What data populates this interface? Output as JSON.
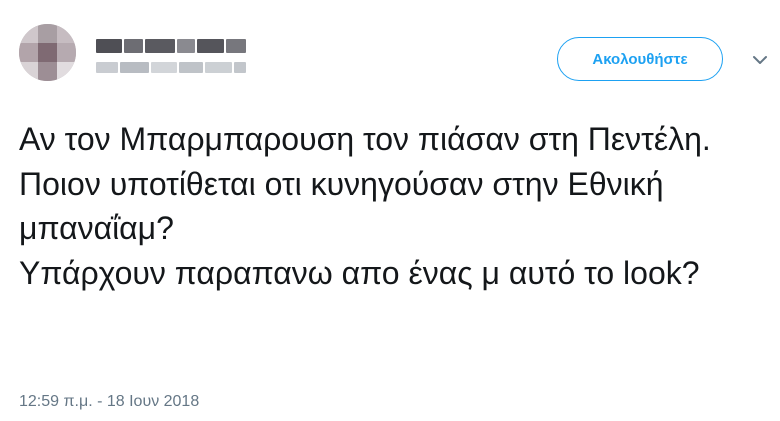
{
  "tweet": {
    "follow_label": "Ακολουθήστε",
    "text": "Αν τον Μπαρμπαρουση τον πιάσαν στη Πεντέλη.\nΠοιον υποτίθεται οτι κυνηγούσαν στην Εθνική μπαναΐαμ?\nΥπάρχουν παραπανω απο ένας μ αυτό το look?",
    "timestamp": "12:59 π.μ. - 18 Ιουν 2018"
  },
  "colors": {
    "accent": "#1da1f2",
    "text": "#14171a",
    "secondary": "#657786"
  },
  "icons": {
    "menu": "chevron-down-icon"
  }
}
